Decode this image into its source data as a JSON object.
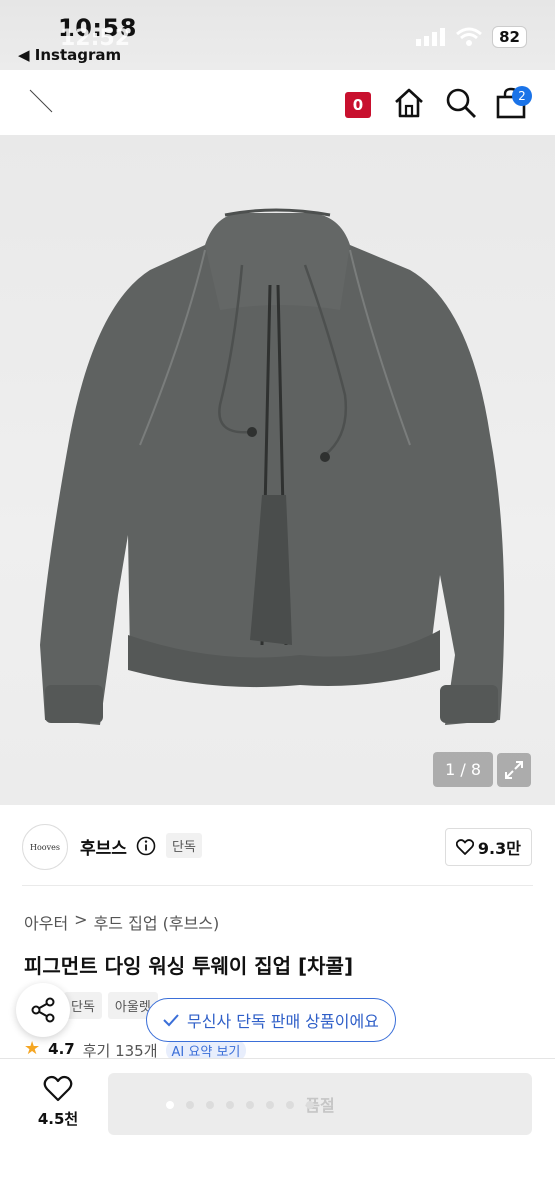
{
  "status_bar": {
    "time": "10:58",
    "time_overlay": "12:52",
    "back_app": "◀ Instagram",
    "battery": "82"
  },
  "header": {
    "cart_count": "0",
    "bag_badge": "2"
  },
  "image": {
    "counter": "1 / 8"
  },
  "brand": {
    "logo_text": "Hooves",
    "name": "후브스",
    "exclusive": "단독",
    "like_count": "9.3만"
  },
  "breadcrumb": {
    "items": [
      "아우터",
      "후드 집업 (후브스)"
    ],
    "separator": ">"
  },
  "product": {
    "title": "피그먼트 다잉 워싱 투웨이 집업 [차콜]",
    "tags": [
      "단독",
      "아울렛"
    ],
    "rating": "4.7",
    "reviews": "후기 135개",
    "ai_summary": "AI 요약 보기"
  },
  "toast": {
    "text": "무신사 단독 판매 상품이에요"
  },
  "bottom": {
    "wish_count": "4.5천",
    "soldout_label": "품절"
  },
  "colors": {
    "accent_red": "#c8102e",
    "accent_blue": "#3b6fd8",
    "jacket": "#5f6261"
  }
}
